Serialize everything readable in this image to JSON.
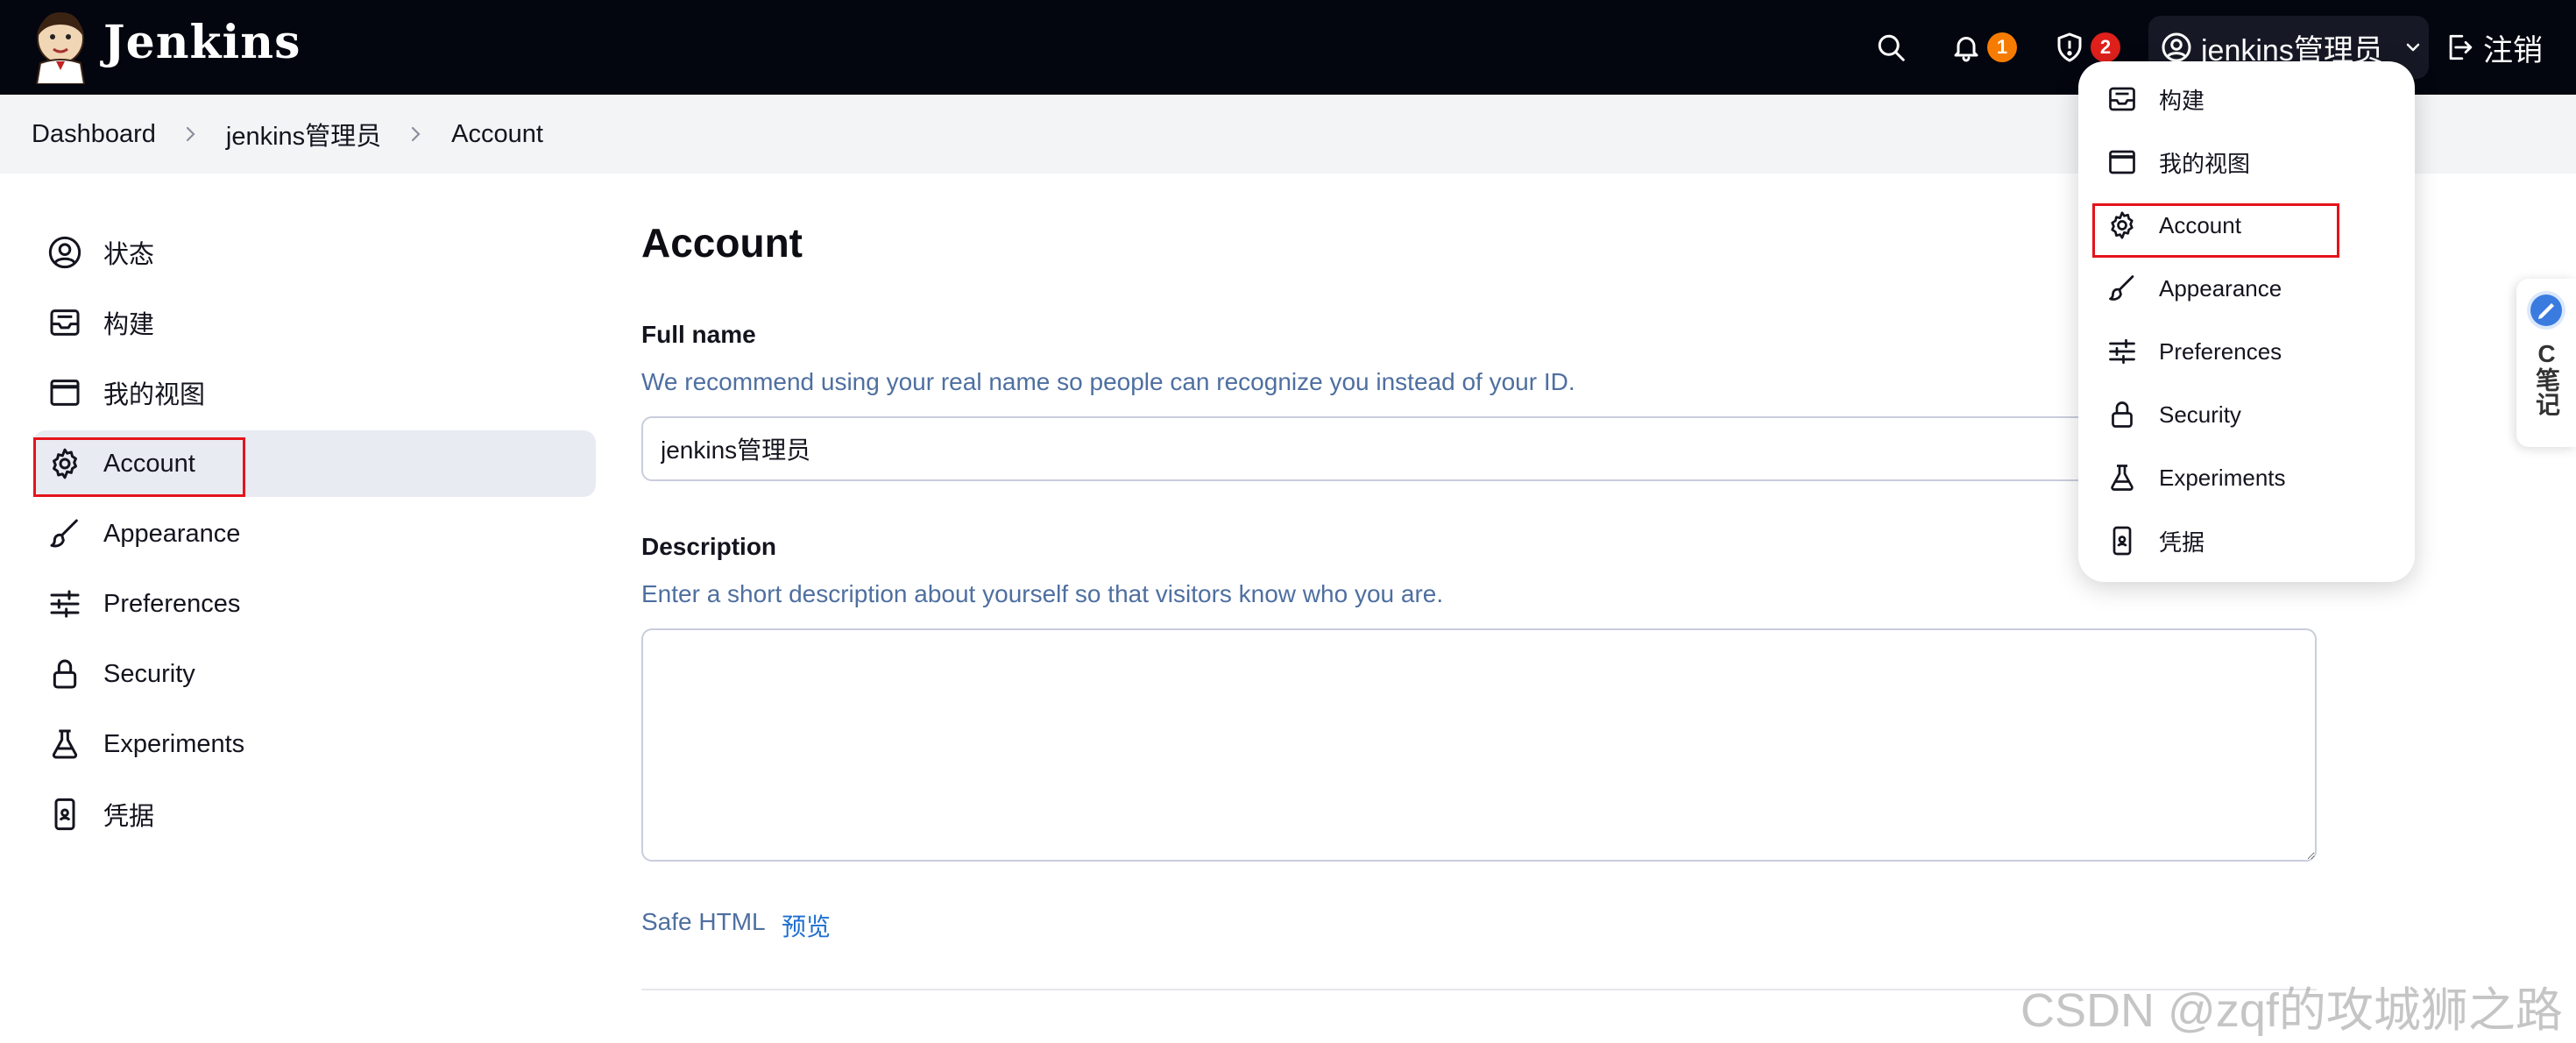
{
  "header": {
    "brand": "Jenkins",
    "notifications_count": "1",
    "security_count": "2",
    "user_name": "jenkins管理员",
    "logout_label": "注销",
    "icons": [
      "jenkins-logo-icon",
      "search-icon",
      "bell-icon",
      "shield-icon",
      "user-circle-icon",
      "chevron-down-icon",
      "logout-icon"
    ]
  },
  "breadcrumb": {
    "items": [
      "Dashboard",
      "jenkins管理员",
      "Account"
    ]
  },
  "sidebar": {
    "items": [
      {
        "label": "状态",
        "icon": "user-circle-icon"
      },
      {
        "label": "构建",
        "icon": "inbox-icon"
      },
      {
        "label": "我的视图",
        "icon": "window-icon"
      },
      {
        "label": "Account",
        "icon": "gear-icon",
        "active": true
      },
      {
        "label": "Appearance",
        "icon": "brush-icon"
      },
      {
        "label": "Preferences",
        "icon": "sliders-icon"
      },
      {
        "label": "Security",
        "icon": "lock-icon"
      },
      {
        "label": "Experiments",
        "icon": "flask-icon"
      },
      {
        "label": "凭据",
        "icon": "credentials-icon"
      }
    ]
  },
  "main": {
    "title": "Account",
    "full_name": {
      "label": "Full name",
      "help": "We recommend using your real name so people can recognize you instead of your ID.",
      "value": "jenkins管理员"
    },
    "description": {
      "label": "Description",
      "help": "Enter a short description about yourself so that visitors know who you are.",
      "value": ""
    },
    "safe_html": "Safe HTML",
    "preview_link": "预览"
  },
  "dropdown": {
    "items": [
      {
        "label": "构建",
        "icon": "inbox-icon"
      },
      {
        "label": "我的视图",
        "icon": "window-icon"
      },
      {
        "label": "Account",
        "icon": "gear-icon"
      },
      {
        "label": "Appearance",
        "icon": "brush-icon"
      },
      {
        "label": "Preferences",
        "icon": "sliders-icon"
      },
      {
        "label": "Security",
        "icon": "lock-icon"
      },
      {
        "label": "Experiments",
        "icon": "flask-icon"
      },
      {
        "label": "凭据",
        "icon": "credentials-icon"
      }
    ]
  },
  "side_widget": {
    "text": "C笔记"
  },
  "watermark": "CSDN @zqf的攻城狮之路",
  "colors": {
    "header_bg": "#03050f",
    "breadcrumb_bg": "#f3f4f6",
    "help_text": "#4e6fa0",
    "link": "#1f6fd0",
    "active_bg": "#e8ebf1",
    "highlight_box": "#e5131b",
    "badge_orange": "#f57c00",
    "badge_red": "#e0201b"
  }
}
